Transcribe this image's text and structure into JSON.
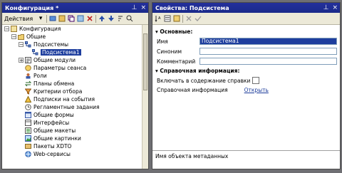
{
  "left": {
    "title": "Конфигурация *",
    "actions": "Действия",
    "tree": [
      {
        "label": "Конфигурация",
        "icon": "config-icon",
        "exp": "-"
      },
      {
        "label": "Общие",
        "icon": "folder-icon",
        "exp": "-"
      },
      {
        "label": "Подсистемы",
        "icon": "subsystem-icon",
        "exp": "-"
      },
      {
        "label": "Подсистема1",
        "icon": "subsystem-icon",
        "selected": true
      },
      {
        "label": "Общие модули",
        "icon": "module-icon",
        "exp": "+"
      },
      {
        "label": "Параметры сеанса",
        "icon": "session-icon"
      },
      {
        "label": "Роли",
        "icon": "role-icon"
      },
      {
        "label": "Планы обмена",
        "icon": "exchange-icon"
      },
      {
        "label": "Критерии отбора",
        "icon": "filter-icon"
      },
      {
        "label": "Подписки на события",
        "icon": "subscription-icon"
      },
      {
        "label": "Регламентные задания",
        "icon": "job-icon"
      },
      {
        "label": "Общие формы",
        "icon": "form-icon"
      },
      {
        "label": "Интерфейсы",
        "icon": "interface-icon"
      },
      {
        "label": "Общие макеты",
        "icon": "template-icon"
      },
      {
        "label": "Общие картинки",
        "icon": "picture-icon"
      },
      {
        "label": "Пакеты XDTO",
        "icon": "xdto-icon"
      },
      {
        "label": "Web-сервисы",
        "icon": "webservice-icon"
      }
    ]
  },
  "right": {
    "title": "Свойства: Подсистема",
    "section_main": "Основные:",
    "section_ref": "Справочная информация:",
    "props": [
      {
        "label": "Имя",
        "value": "Подсистема1"
      },
      {
        "label": "Синоним",
        "value": ""
      },
      {
        "label": "Комментарий",
        "value": ""
      }
    ],
    "include_help": "Включать в содержание справки",
    "help_label": "Справочная информация",
    "help_link": "Открыть",
    "status": "Имя объекта метаданных"
  }
}
